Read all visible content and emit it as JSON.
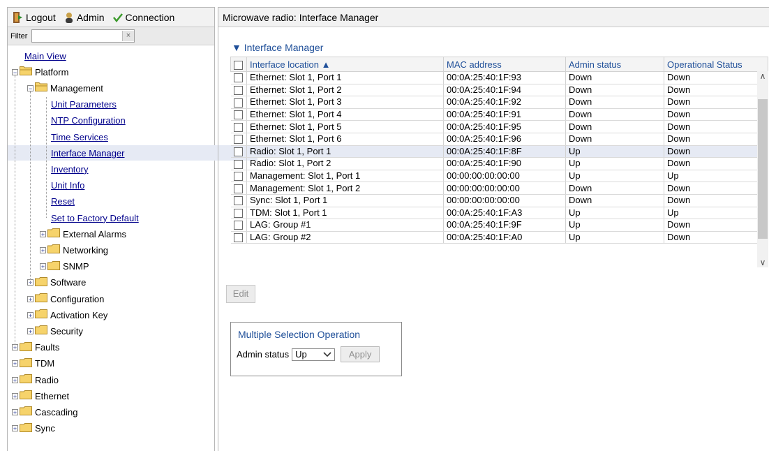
{
  "toolbar": {
    "logout": "Logout",
    "admin": "Admin",
    "connection": "Connection"
  },
  "filter": {
    "label": "Filter",
    "value": "",
    "clear": "×"
  },
  "tree": {
    "main_view": "Main View",
    "platform": "Platform",
    "management": "Management",
    "mgmt_items": [
      "Unit Parameters",
      "NTP Configuration",
      "Time Services",
      "Interface Manager",
      "Inventory",
      "Unit Info",
      "Reset",
      "Set to Factory Default"
    ],
    "mgmt_folders": [
      "External Alarms",
      "Networking",
      "SNMP"
    ],
    "platform_folders": [
      "Software",
      "Configuration",
      "Activation Key",
      "Security"
    ],
    "top_folders": [
      "Faults",
      "TDM",
      "Radio",
      "Ethernet",
      "Cascading",
      "Sync"
    ]
  },
  "page": {
    "title": "Microwave radio: Interface Manager",
    "section": "▼ Interface Manager"
  },
  "table": {
    "columns": [
      "Interface location ▲",
      "MAC address",
      "Admin status",
      "Operational Status"
    ],
    "rows": [
      [
        "Ethernet: Slot 1, Port 1",
        "00:0A:25:40:1F:93",
        "Down",
        "Down"
      ],
      [
        "Ethernet: Slot 1, Port 2",
        "00:0A:25:40:1F:94",
        "Down",
        "Down"
      ],
      [
        "Ethernet: Slot 1, Port 3",
        "00:0A:25:40:1F:92",
        "Down",
        "Down"
      ],
      [
        "Ethernet: Slot 1, Port 4",
        "00:0A:25:40:1F:91",
        "Down",
        "Down"
      ],
      [
        "Ethernet: Slot 1, Port 5",
        "00:0A:25:40:1F:95",
        "Down",
        "Down"
      ],
      [
        "Ethernet: Slot 1, Port 6",
        "00:0A:25:40:1F:96",
        "Down",
        "Down"
      ],
      [
        "Radio: Slot 1, Port 1",
        "00:0A:25:40:1F:8F",
        "Up",
        "Down"
      ],
      [
        "Radio: Slot 1, Port 2",
        "00:0A:25:40:1F:90",
        "Up",
        "Down"
      ],
      [
        "Management: Slot 1, Port 1",
        "00:00:00:00:00:00",
        "Up",
        "Up"
      ],
      [
        "Management: Slot 1, Port 2",
        "00:00:00:00:00:00",
        "Down",
        "Down"
      ],
      [
        "Sync: Slot 1, Port 1",
        "00:00:00:00:00:00",
        "Down",
        "Down"
      ],
      [
        "TDM: Slot 1, Port 1",
        "00:0A:25:40:1F:A3",
        "Up",
        "Up"
      ],
      [
        "LAG: Group #1",
        "00:0A:25:40:1F:9F",
        "Up",
        "Down"
      ],
      [
        "LAG: Group #2",
        "00:0A:25:40:1F:A0",
        "Up",
        "Down"
      ]
    ]
  },
  "buttons": {
    "edit": "Edit",
    "apply": "Apply"
  },
  "multi": {
    "title": "Multiple Selection Operation",
    "admin_label": "Admin status",
    "admin_value": "Up"
  }
}
